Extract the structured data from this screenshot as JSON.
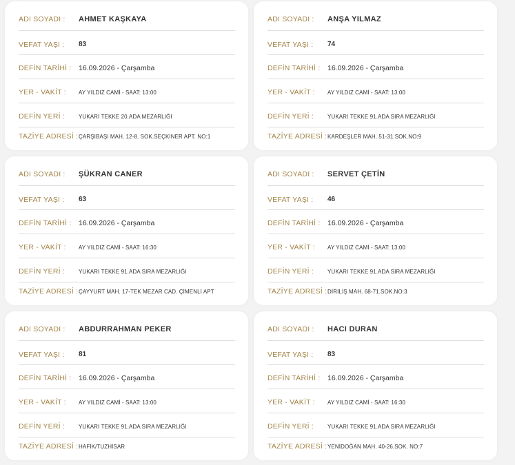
{
  "labels": {
    "name": "ADI SOYADI :",
    "age": "VEFAT YAŞI :",
    "burial_date": "DEFİN TARİHİ :",
    "place_time": "YER - VAKİT :",
    "burial_place": "DEFİN YERİ :",
    "condolence": "TAZİYE ADRESİ :"
  },
  "notices": [
    {
      "name": "AHMET KAŞKAYA",
      "age": "83",
      "burial_date": "16.09.2026 - Çarşamba",
      "place_time": "AY YILDIZ CAMİ - SAAT: 13:00",
      "burial_place": "YUKARI TEKKE 20.ADA MEZARLIĞI",
      "condolence": "ÇARŞIBAŞI MAH. 12-8. SOK.SEÇKİNER APT. NO:1"
    },
    {
      "name": "ANŞA YILMAZ",
      "age": "74",
      "burial_date": "16.09.2026 - Çarşamba",
      "place_time": "AY YILDIZ CAMİ - SAAT: 13:00",
      "burial_place": "YUKARI TEKKE 91.ADA SIRA MEZARLIĞI",
      "condolence": "KARDEŞLER MAH. 51-31.SOK.NO:9"
    },
    {
      "name": "ŞÜKRAN CANER",
      "age": "63",
      "burial_date": "16.09.2026 - Çarşamba",
      "place_time": "AY YILDIZ CAMİ - SAAT: 16:30",
      "burial_place": "YUKARI TEKKE 91.ADA SIRA MEZARLIĞI",
      "condolence": "ÇAYYURT MAH. 17-TEK MEZAR CAD. ÇİMENLİ APT"
    },
    {
      "name": "SERVET ÇETİN",
      "age": "46",
      "burial_date": "16.09.2026 - Çarşamba",
      "place_time": "AY YILDIZ CAMİ - SAAT: 13:00",
      "burial_place": "YUKARI TEKKE 91.ADA SIRA MEZARLIĞI",
      "condolence": "DİRİLİŞ MAH. 68-71.SOK.NO:3"
    },
    {
      "name": "ABDURRAHMAN PEKER",
      "age": "81",
      "burial_date": "16.09.2026 - Çarşamba",
      "place_time": "AY YILDIZ CAMİ - SAAT: 13:00",
      "burial_place": "YUKARI TEKKE 91.ADA SIRA MEZARLIĞI",
      "condolence": "HAFİK/TUZHİSAR"
    },
    {
      "name": "HACI DURAN",
      "age": "83",
      "burial_date": "16.09.2026 - Çarşamba",
      "place_time": "AY YILDIZ CAMİ - SAAT: 16:30",
      "burial_place": "YUKARI TEKKE 91.ADA SIRA MEZARLIĞI",
      "condolence": "YENİDOĞAN MAH. 40-26.SOK. NO:7"
    }
  ]
}
